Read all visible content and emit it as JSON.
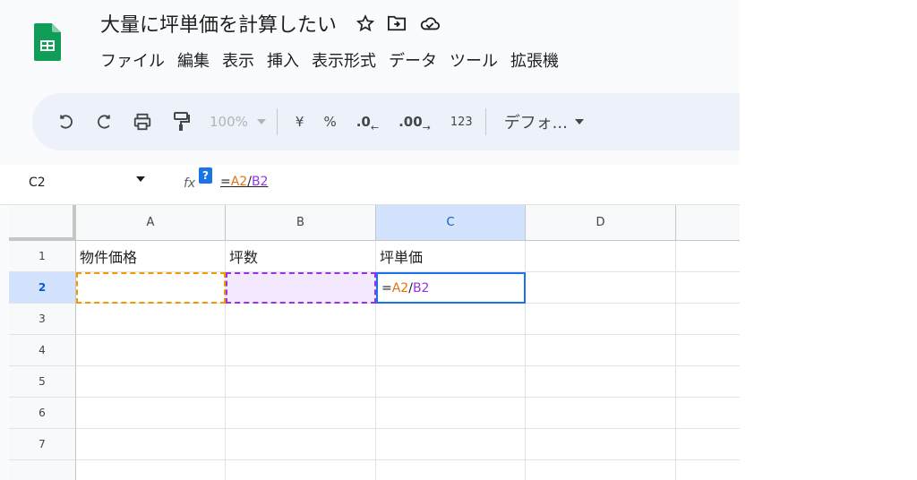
{
  "title": "大量に坪単価を計算したい",
  "title_icons": [
    "star-icon",
    "move-to-folder-icon",
    "cloud-status-icon"
  ],
  "menu": [
    "ファイル",
    "編集",
    "表示",
    "挿入",
    "表示形式",
    "データ",
    "ツール",
    "拡張機"
  ],
  "toolbar": {
    "zoom": "100%",
    "currency": "¥",
    "percent": "%",
    "dec_decrease": ".0",
    "dec_increase": ".00",
    "number_format": "123",
    "font": "デフォ..."
  },
  "formula_bar": {
    "name_box": "C2",
    "fx": "fx",
    "help": "?",
    "formula_eq": "=",
    "formula_a": "A2",
    "formula_slash": "/",
    "formula_b": "B2"
  },
  "columns": [
    "A",
    "B",
    "C",
    "D"
  ],
  "rows": [
    "1",
    "2",
    "3",
    "4",
    "5",
    "6",
    "7"
  ],
  "cells": {
    "A1": "物件価格",
    "B1": "坪数",
    "C1": "坪単価",
    "C2_eq": "=",
    "C2_a": "A2",
    "C2_slash": "/",
    "C2_b": "B2"
  },
  "colors": {
    "sheets_green": "#0f9d58",
    "selection_blue": "#1a73e8",
    "ref_orange": "#f29900",
    "ref_purple": "#9334e6"
  }
}
